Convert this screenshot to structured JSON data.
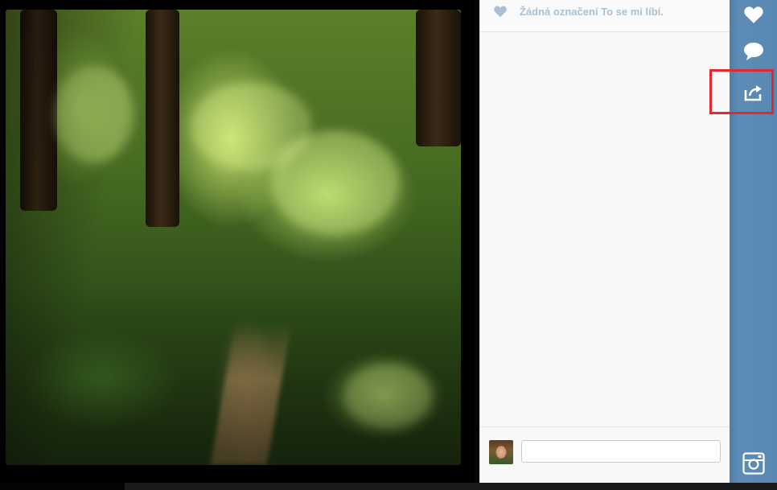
{
  "photo": {
    "alt_icon": "forest-photo"
  },
  "panel": {
    "likes_text": "Žádná označení To se mi líbí.",
    "heart_icon": "heart-icon"
  },
  "comment": {
    "input_value": "",
    "input_placeholder": "",
    "avatar_icon": "avatar"
  },
  "rail": {
    "like_icon": "heart-icon",
    "comment_icon": "speech-bubble-icon",
    "share_icon": "share-icon",
    "instagram_icon": "instagram-icon"
  },
  "colors": {
    "rail_blue": "#5887b1",
    "likes_text": "#a8bfd4",
    "highlight": "#e0282e"
  }
}
